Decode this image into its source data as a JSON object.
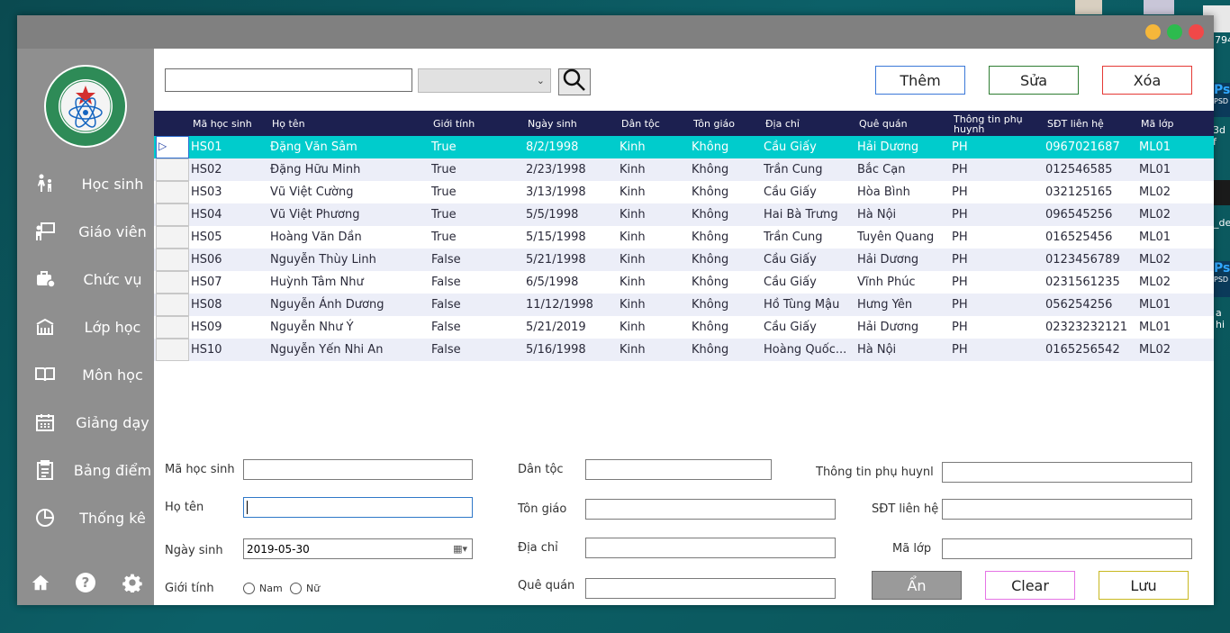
{
  "window": {
    "controls": {
      "minimize_color": "#f5b73a",
      "maximize_color": "#2dbb4e",
      "close_color": "#f04848"
    }
  },
  "desktop": {
    "fragments": [
      "794",
      "Ps",
      "PSD",
      "3d f",
      "_dep",
      "Ps",
      "PSD",
      "a hi"
    ]
  },
  "sidebar": {
    "logo_text": "HỌC VIỆN KỸ THUẬT QUÂN SỰ · MILITARY TECHNICAL ACADEMY",
    "items": [
      {
        "label": "Học sinh",
        "icon": "student-icon"
      },
      {
        "label": "Giáo viên",
        "icon": "teacher-icon"
      },
      {
        "label": "Chức vụ",
        "icon": "briefcase-icon"
      },
      {
        "label": "Lớp học",
        "icon": "classroom-icon"
      },
      {
        "label": "Môn học",
        "icon": "book-icon"
      },
      {
        "label": "Giảng dạy",
        "icon": "calendar-icon"
      },
      {
        "label": "Bảng điểm",
        "icon": "clipboard-icon"
      },
      {
        "label": "Thống kê",
        "icon": "chart-icon"
      }
    ],
    "bottom_icons": [
      "home-icon",
      "help-icon",
      "gear-icon"
    ]
  },
  "toolbar": {
    "search_value": "",
    "filter_value": "",
    "add_label": "Thêm",
    "edit_label": "Sửa",
    "delete_label": "Xóa",
    "colors": {
      "add": "#3b78d8",
      "edit": "#2e7d32",
      "delete": "#e53935"
    }
  },
  "grid": {
    "columns": [
      "Mã học sinh",
      "Họ tên",
      "Giới tính",
      "Ngày sinh",
      "Dân tộc",
      "Tôn giáo",
      "Địa chỉ",
      "Quê quán",
      "Thông tin phụ huynh",
      "SĐT liên hệ",
      "Mã lớp"
    ],
    "rows": [
      [
        "HS01",
        "Đặng Văn Sâm",
        "True",
        "8/2/1998",
        "Kinh",
        "Không",
        "Cầu Giấy",
        "Hải Dương",
        "PH",
        "0967021687",
        "ML01"
      ],
      [
        "HS02",
        "Đặng Hữu Minh",
        "True",
        "2/23/1998",
        "Kinh",
        "Không",
        "Trần Cung",
        "Bắc Cạn",
        "PH",
        "012546585",
        "ML01"
      ],
      [
        "HS03",
        "Vũ Việt Cường",
        "True",
        "3/13/1998",
        "Kinh",
        "Không",
        "Cầu Giấy",
        "Hòa Bình",
        "PH",
        "032125165",
        "ML02"
      ],
      [
        "HS04",
        "Vũ Việt Phương",
        "True",
        "5/5/1998",
        "Kinh",
        "Không",
        "Hai Bà Trưng",
        "Hà Nội",
        "PH",
        "096545256",
        "ML02"
      ],
      [
        "HS05",
        "Hoàng Văn Dần",
        "True",
        "5/15/1998",
        "Kinh",
        "Không",
        "Trần Cung",
        "Tuyên Quang",
        "PH",
        "016525456",
        "ML01"
      ],
      [
        "HS06",
        "Nguyễn Thùy Linh",
        "False",
        "5/21/1998",
        "Kinh",
        "Không",
        "Cầu Giấy",
        "Hải Dương",
        "PH",
        "0123456789",
        "ML02"
      ],
      [
        "HS07",
        "Huỳnh Tâm Như",
        "False",
        "6/5/1998",
        "Kinh",
        "Không",
        "Cầu Giấy",
        "Vĩnh Phúc",
        "PH",
        "0231561235",
        "ML02"
      ],
      [
        "HS08",
        "Nguyễn Ánh Dương",
        "False",
        "11/12/1998",
        "Kinh",
        "Không",
        "Hồ Tùng Mậu",
        "Hưng Yên",
        "PH",
        "056254256",
        "ML01"
      ],
      [
        "HS09",
        "Nguyễn Như Ý",
        "False",
        "5/21/2019",
        "Kinh",
        "Không",
        "Cầu Giấy",
        "Hải Dương",
        "PH",
        "02323232121",
        "ML01"
      ],
      [
        "HS10",
        "Nguyễn Yến Nhi An",
        "False",
        "5/16/1998",
        "Kinh",
        "Không",
        "Hoàng Quốc...",
        "Hà Nội",
        "PH",
        "0165256542",
        "ML02"
      ]
    ],
    "selected_row_color": "#00cccc",
    "alt_row_color": "#eceef8",
    "header_color": "#1c2050"
  },
  "form": {
    "student_id": {
      "label": "Mã học sinh",
      "value": ""
    },
    "full_name": {
      "label": "Họ tên",
      "value": ""
    },
    "birth_date": {
      "label": "Ngày sinh",
      "value": "2019-05-30"
    },
    "gender": {
      "label": "Giới tính",
      "options": [
        "Nam",
        "Nữ"
      ]
    },
    "ethnicity": {
      "label": "Dân tộc",
      "value": ""
    },
    "religion": {
      "label": "Tôn giáo",
      "value": ""
    },
    "address": {
      "label": "Địa chỉ",
      "value": ""
    },
    "hometown": {
      "label": "Quê quán",
      "value": ""
    },
    "parent_info": {
      "label": "Thông tin phụ huynl",
      "value": ""
    },
    "phone": {
      "label": "SĐT liên hệ",
      "value": ""
    },
    "class_id": {
      "label": "Mã lớp",
      "value": ""
    }
  },
  "actions": {
    "hide_label": "Ẩn",
    "clear_label": "Clear",
    "save_label": "Lưu",
    "colors": {
      "hide_bg": "#9a9a9a",
      "clear_border": "#e573e5",
      "save_border": "#c8b820"
    }
  }
}
